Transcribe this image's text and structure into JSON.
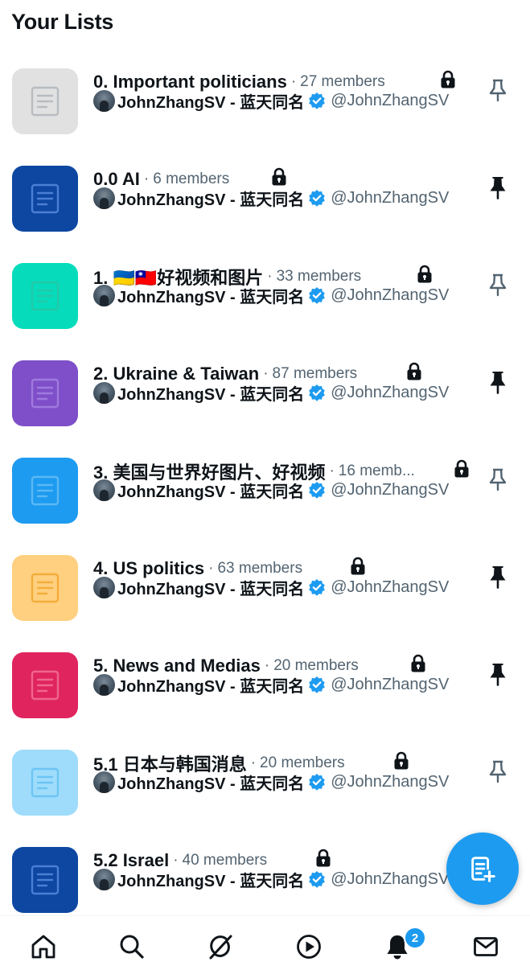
{
  "header": {
    "title": "Your Lists"
  },
  "separator": "·",
  "owner": {
    "name": "JohnZhangSV - 蓝天同名",
    "handle": "@JohnZhangSV",
    "verified_color": "#1d9bf0"
  },
  "lists": [
    {
      "name": "0. Important politicians",
      "members": "27 members",
      "color": "#e1e1e1",
      "glyph": "#b8bcc0",
      "pinned": false,
      "private": true
    },
    {
      "name": "0.0 AI",
      "members": "6 members",
      "color": "#0d47a1",
      "glyph": "#4a7fd4",
      "pinned": true,
      "private": true
    },
    {
      "name": "1. 🇺🇦🇹🇼好视频和图片",
      "members": "33 members",
      "color": "#06dcbc",
      "glyph": "#24c8a8",
      "pinned": false,
      "private": true
    },
    {
      "name": "2. Ukraine & Taiwan",
      "members": "87 members",
      "color": "#7e4fc8",
      "glyph": "#a07ade",
      "pinned": true,
      "private": true
    },
    {
      "name": "3. 美国与世界好图片、好视频",
      "members": "16 memb...",
      "color": "#1d9bf0",
      "glyph": "#5cb8f4",
      "pinned": false,
      "private": true
    },
    {
      "name": "4. US politics",
      "members": "63 members",
      "color": "#ffd080",
      "glyph": "#f5ad3a",
      "pinned": true,
      "private": true
    },
    {
      "name": "5. News and Medias",
      "members": "20 members",
      "color": "#e0245e",
      "glyph": "#ef6690",
      "pinned": true,
      "private": true
    },
    {
      "name": "5.1 日本与韩国消息",
      "members": "20 members",
      "color": "#9fdcfb",
      "glyph": "#6cc5f4",
      "pinned": false,
      "private": true
    },
    {
      "name": "5.2 Israel",
      "members": "40 members",
      "color": "#0d47a1",
      "glyph": "#4a7fd4",
      "pinned": false,
      "private": true
    }
  ],
  "fab": {
    "icon": "new-list-icon"
  },
  "bottom_nav": {
    "items": [
      "home-icon",
      "search-icon",
      "grok-icon",
      "video-icon",
      "notifications-icon",
      "messages-icon"
    ],
    "notifications_badge": "2"
  },
  "colors": {
    "accent": "#1d9bf0",
    "text_primary": "#0f1419",
    "text_secondary": "#536471"
  }
}
